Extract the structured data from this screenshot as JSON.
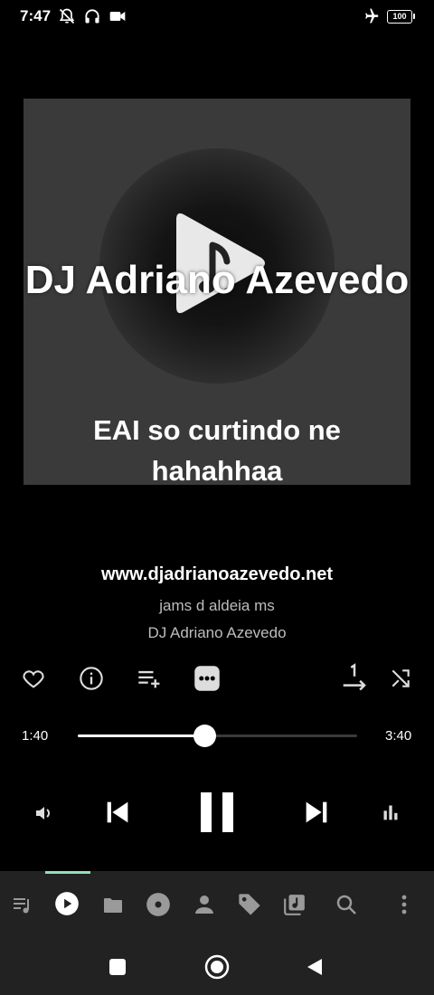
{
  "status_bar": {
    "time": "7:47",
    "battery": "100"
  },
  "artwork": {
    "artist_overlay": "DJ Adriano Azevedo",
    "message_line1": "EAI so curtindo ne",
    "message_line2": "hahahhaa"
  },
  "track": {
    "title": "www.djadrianoazevedo.net",
    "album": "jams d aldeia ms",
    "artist": "DJ Adriano Azevedo"
  },
  "progress": {
    "elapsed": "1:40",
    "total": "3:40",
    "fraction": 0.455
  },
  "colors": {
    "accent": "#8fe0b6",
    "background": "#000000",
    "panel": "#222222"
  },
  "tabs": [
    {
      "icon": "queue-music-icon"
    },
    {
      "icon": "now-playing-icon",
      "active": true
    },
    {
      "icon": "folder-icon"
    },
    {
      "icon": "album-icon"
    },
    {
      "icon": "artist-icon"
    },
    {
      "icon": "tag-icon"
    },
    {
      "icon": "playlist-icon"
    },
    {
      "icon": "search-icon"
    },
    {
      "icon": "more-vert-icon"
    }
  ]
}
